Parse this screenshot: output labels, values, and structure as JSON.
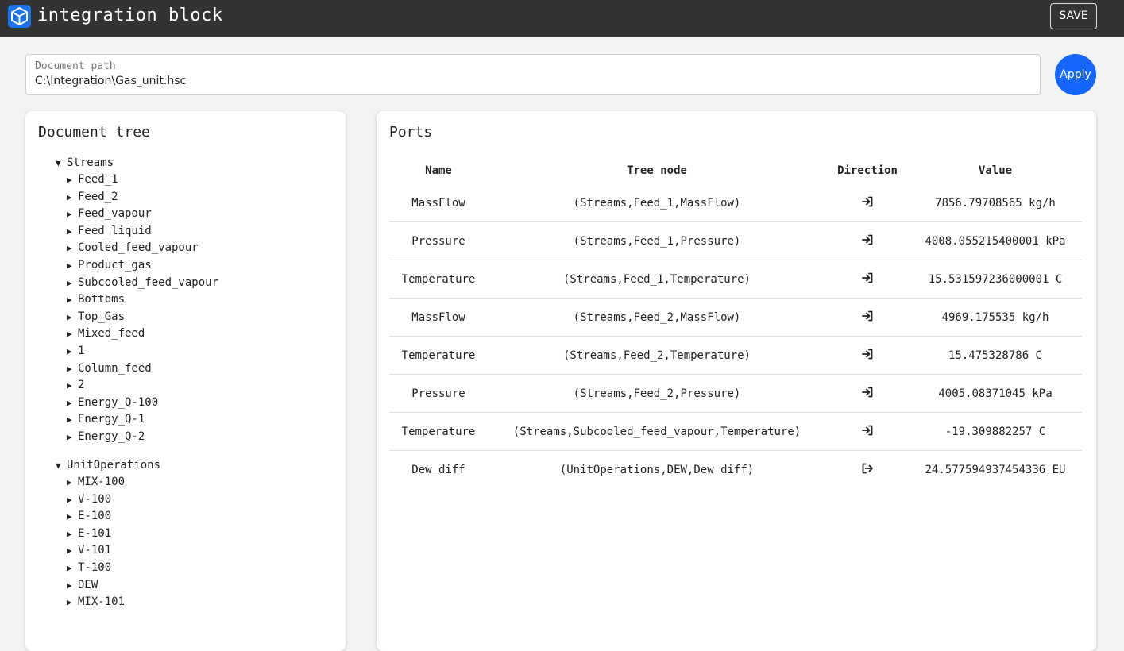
{
  "header": {
    "app_title": "integration block",
    "save_label": "SAVE"
  },
  "document_path": {
    "label": "Document path",
    "value": "C:\\Integration\\Gas_unit.hsc",
    "apply_label": "Apply"
  },
  "tree": {
    "title": "Document tree",
    "groups": [
      {
        "label": "Streams",
        "expanded": true,
        "items": [
          "Feed_1",
          "Feed_2",
          "Feed_vapour",
          "Feed_liquid",
          "Cooled_feed_vapour",
          "Product_gas",
          "Subcooled_feed_vapour",
          "Bottoms",
          "Top_Gas",
          "Mixed_feed",
          "1",
          "Column_feed",
          "2",
          "Energy_Q-100",
          "Energy_Q-1",
          "Energy_Q-2"
        ]
      },
      {
        "label": "UnitOperations",
        "expanded": true,
        "items": [
          "MIX-100",
          "V-100",
          "E-100",
          "E-101",
          "V-101",
          "T-100",
          "DEW",
          "MIX-101"
        ]
      }
    ]
  },
  "ports": {
    "title": "Ports",
    "columns": [
      "Name",
      "Tree node",
      "Direction",
      "Value"
    ],
    "rows": [
      {
        "name": "MassFlow",
        "node": "(Streams,Feed_1,MassFlow)",
        "direction": "input",
        "direction_icon": "login-arrow-icon",
        "value": "7856.79708565 kg/h"
      },
      {
        "name": "Pressure",
        "node": "(Streams,Feed_1,Pressure)",
        "direction": "input",
        "direction_icon": "login-arrow-icon",
        "value": "4008.055215400001 kPa"
      },
      {
        "name": "Temperature",
        "node": "(Streams,Feed_1,Temperature)",
        "direction": "input",
        "direction_icon": "login-arrow-icon",
        "value": "15.531597236000001 C"
      },
      {
        "name": "MassFlow",
        "node": "(Streams,Feed_2,MassFlow)",
        "direction": "input",
        "direction_icon": "login-arrow-icon",
        "value": "4969.175535 kg/h"
      },
      {
        "name": "Temperature",
        "node": "(Streams,Feed_2,Temperature)",
        "direction": "input",
        "direction_icon": "login-arrow-icon",
        "value": "15.475328786 C"
      },
      {
        "name": "Pressure",
        "node": "(Streams,Feed_2,Pressure)",
        "direction": "input",
        "direction_icon": "login-arrow-icon",
        "value": "4005.08371045 kPa"
      },
      {
        "name": "Temperature",
        "node": "(Streams,Subcooled_feed_vapour,Temperature)",
        "direction": "input",
        "direction_icon": "login-arrow-icon",
        "value": "-19.309882257 C"
      },
      {
        "name": "Dew_diff",
        "node": "(UnitOperations,DEW,Dew_diff)",
        "direction": "output",
        "direction_icon": "logout-arrow-icon",
        "value": "24.577594937454336 EU"
      }
    ]
  },
  "colors": {
    "topbar": "#333333",
    "accent": "#1565ff",
    "logo": "#1a73e8"
  }
}
